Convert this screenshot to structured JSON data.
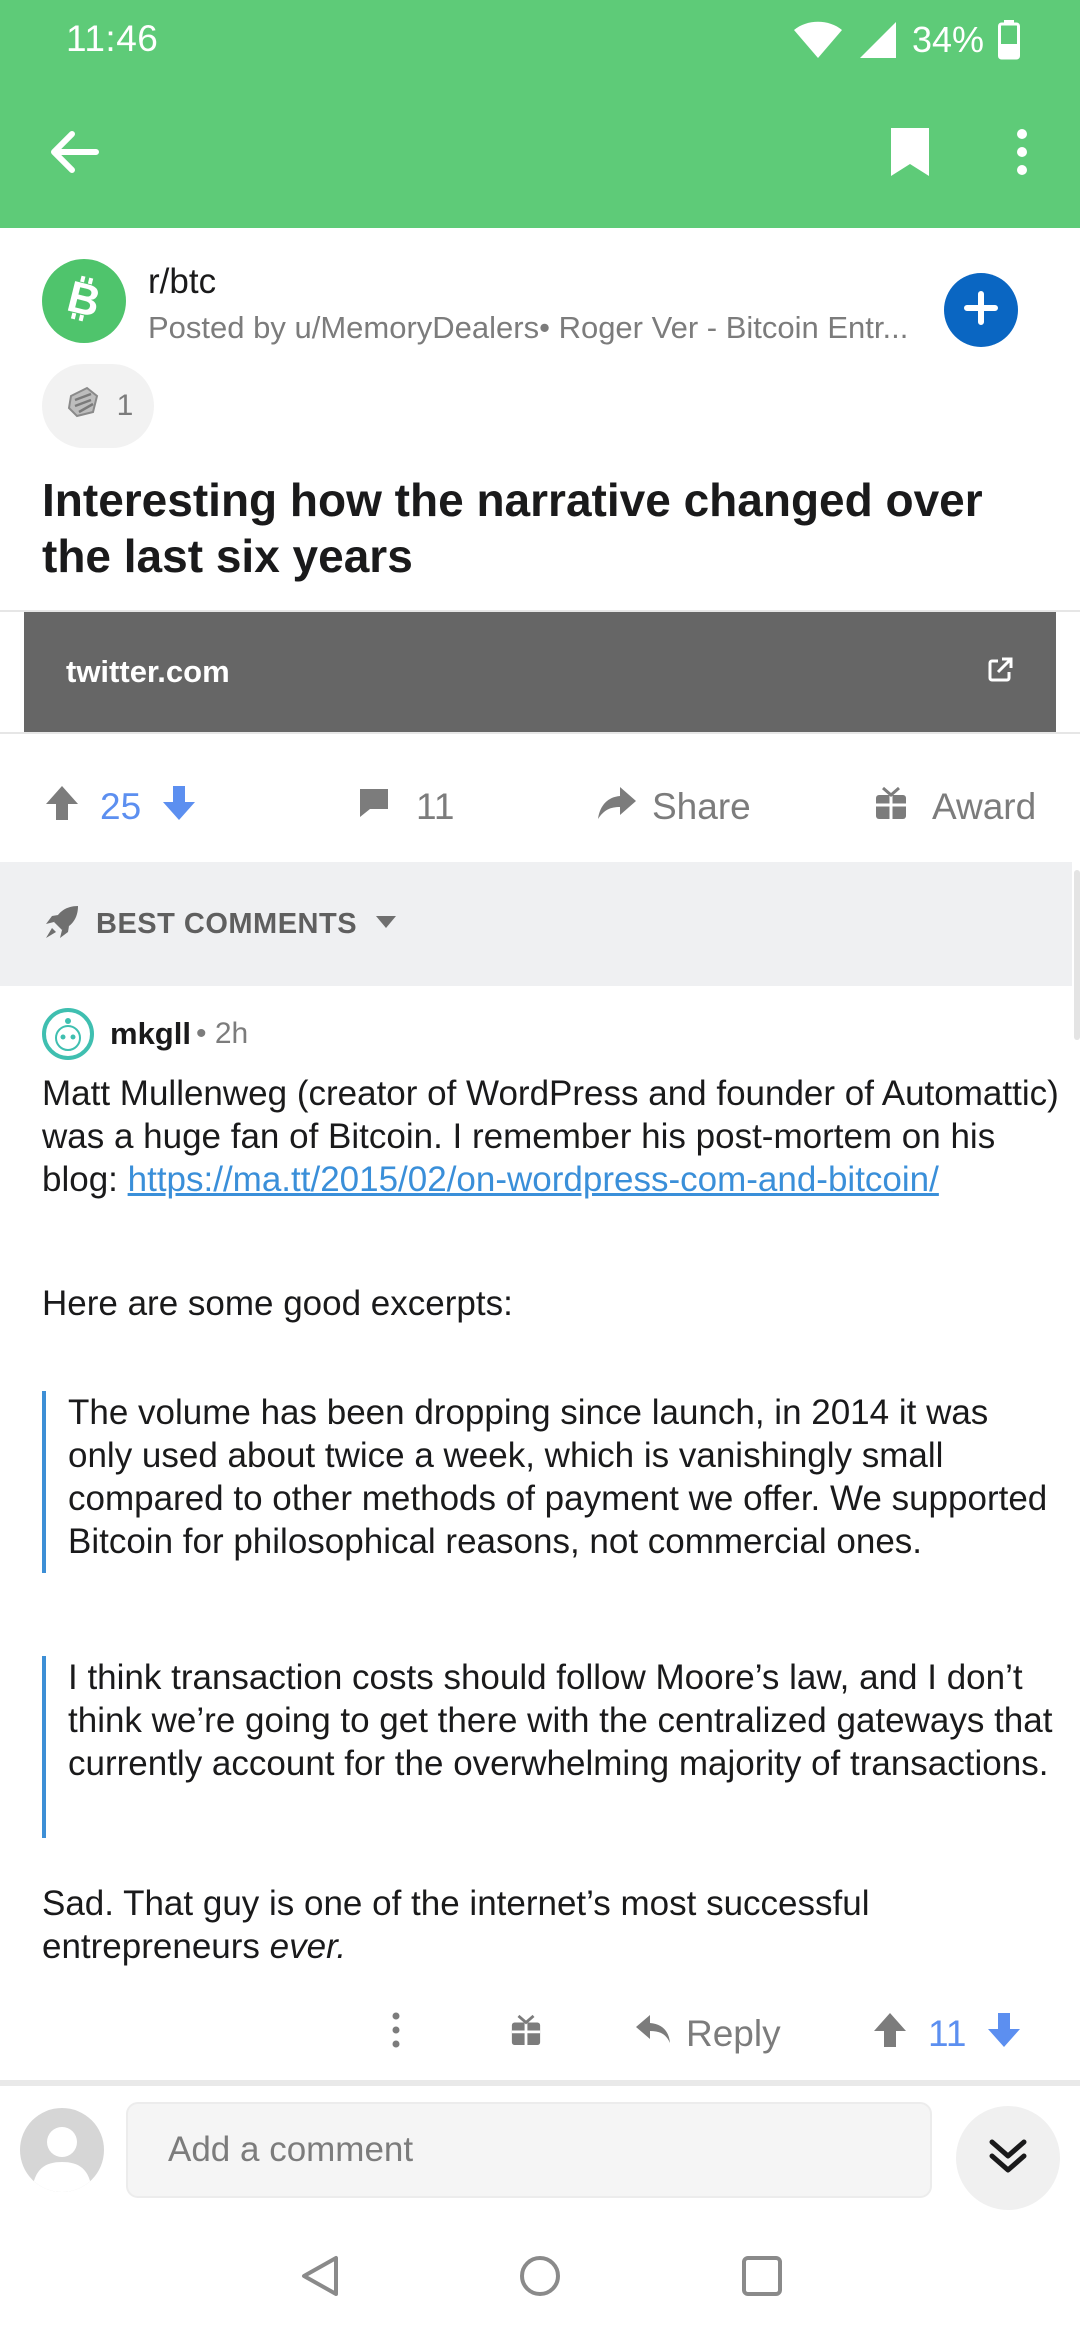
{
  "status_bar": {
    "time": "11:46",
    "battery": "34%"
  },
  "toolbar": {
    "back_icon": "arrow-left-icon",
    "bookmark_icon": "bookmark-icon",
    "more_icon": "more-vertical-icon",
    "color": "#5ecb78"
  },
  "post": {
    "subreddit": "r/btc",
    "posted_by": "Posted by u/MemoryDealers• Roger Ver - Bitcoin Entr...",
    "award_count": "1",
    "title": "Interesting how the narrative changed over the last six years",
    "link_domain": "twitter.com",
    "votes": "25",
    "comments": "11",
    "share_label": "Share",
    "award_label": "Award"
  },
  "sort": {
    "label": "BEST COMMENTS"
  },
  "comment": {
    "author": "mkgll",
    "time": "• 2h",
    "intro": "Matt Mullenweg (creator of WordPress and founder of Automattic) was a huge fan of Bitcoin. I remember his post-mortem on his blog: ",
    "link": "https://ma.tt/2015/02/on-wordpress-com-and-bitcoin/",
    "para2": "Here are some good excerpts:",
    "quote1": "The volume has been dropping since launch, in 2014 it was only used about twice a week, which is vanishingly small compared to other methods of payment we offer. We supported Bitcoin for philosophical reasons, not commercial ones.",
    "quote2": "I think transaction costs should follow Moore’s law, and I don’t think we’re going to get there with the centralized gateways that currently account for the overwhelming majority of transactions.",
    "closing_text": "Sad. That guy is one of the internet’s most successful entrepreneurs ",
    "closing_emphasis": "ever.",
    "reply_label": "Reply",
    "votes": "11"
  },
  "compose": {
    "placeholder": "Add a comment"
  },
  "colors": {
    "accent": "#5ecb78",
    "vote": "#5c8ff0",
    "link": "#3a8fd9",
    "join": "#0a66c2"
  }
}
